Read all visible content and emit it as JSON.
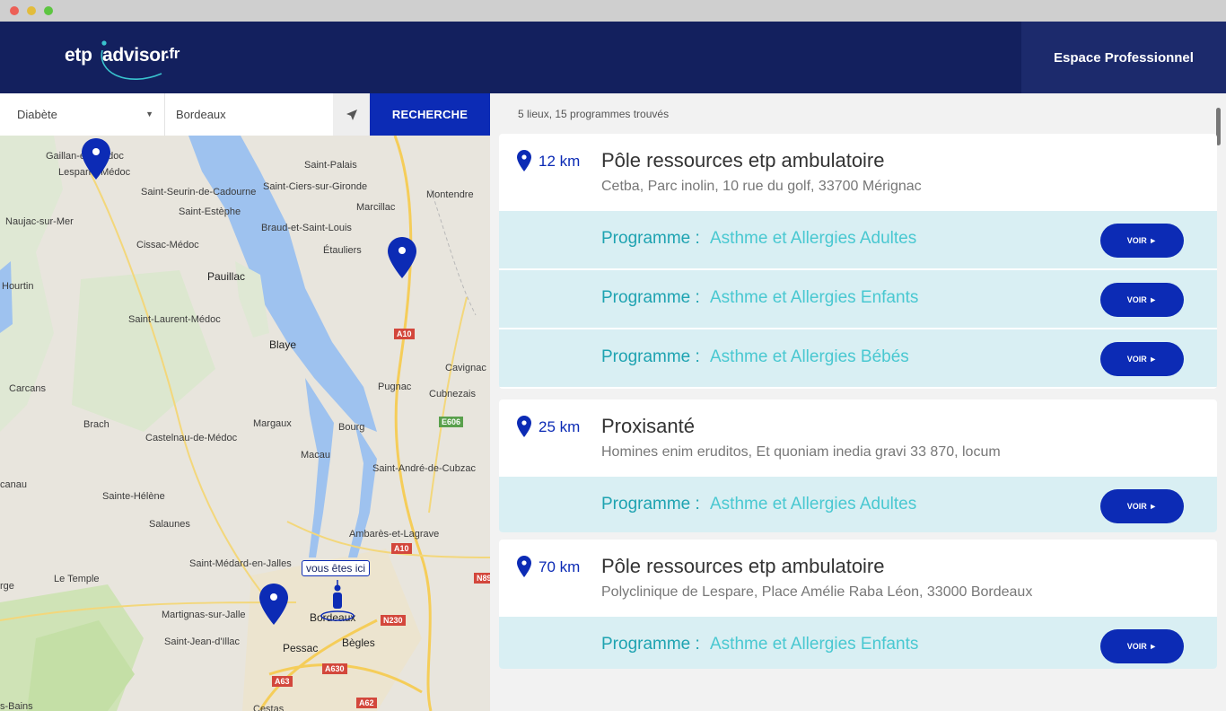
{
  "window": {
    "controls": [
      "close",
      "minimize",
      "maximize"
    ]
  },
  "header": {
    "logo_etp": "etp",
    "logo_advisor": "advisor",
    "logo_fr": ".fr",
    "pro_label": "Espace Professionnel"
  },
  "search": {
    "disease_value": "Diabète",
    "city_value": "Bordeaux",
    "search_label": "RECHERCHE"
  },
  "map": {
    "you_label": "vous êtes ici",
    "places": [
      "Gaillan-en-Médoc",
      "Lesparre-Médoc",
      "Saint-Seurin-de-Cadourne",
      "Saint-Estèphe",
      "Naujac-sur-Mer",
      "Cissac-Médoc",
      "Pauillac",
      "Hourtin",
      "Saint-Laurent-Médoc",
      "Saint-Palais",
      "Saint-Ciers-sur-Gironde",
      "Montendre",
      "Marcillac",
      "Braud-et-Saint-Louis",
      "Étauliers",
      "Blaye",
      "Cavignac",
      "Pugnac",
      "Cubnezais",
      "Carcans",
      "Brach",
      "Castelnau-de-Médoc",
      "Margaux",
      "Bourg",
      "Macau",
      "Saint-André-de-Cubzac",
      "canau",
      "Sainte-Hélène",
      "Salaunes",
      "Ambarès-et-Lagrave",
      "Saint-Médard-en-Jalles",
      "Le Temple",
      "rge",
      "Martignas-sur-Jalle",
      "Saint-Jean-d'Illac",
      "Pessac",
      "Bordeaux",
      "Bègles",
      "s-Bains",
      "Cestas"
    ],
    "roads": [
      "A10",
      "E606",
      "A10",
      "N89",
      "N230",
      "A630",
      "A63",
      "A62"
    ]
  },
  "results": {
    "summary": "5 lieux, 15  programmes trouvés",
    "program_prefix": "Programme :",
    "voir_label": "VOIR",
    "cards": [
      {
        "km": "12 km",
        "title": "Pôle ressources etp ambulatoire",
        "address": "Cetba, Parc inolin, 10 rue du golf, 33700 Mérignac",
        "programs": [
          "Asthme et Allergies Adultes",
          "Asthme et Allergies Enfants",
          "Asthme et Allergies Bébés"
        ]
      },
      {
        "km": "25 km",
        "title": "Proxisanté",
        "address": "Homines enim eruditos, Et quoniam inedia gravi 33 870, locum",
        "programs": [
          "Asthme et Allergies Adultes"
        ]
      },
      {
        "km": "70 km",
        "title": "Pôle ressources etp ambulatoire",
        "address": "Polyclinique de Lespare, Place Amélie Raba Léon, 33000 Bordeaux",
        "programs": [
          "Asthme et Allergies Enfants"
        ]
      }
    ]
  },
  "colors": {
    "navy": "#13205e",
    "primary": "#0c2bb5",
    "teal": "#1ea3b1",
    "aqua": "#49c8d1",
    "program_bg": "#d9eff3"
  }
}
